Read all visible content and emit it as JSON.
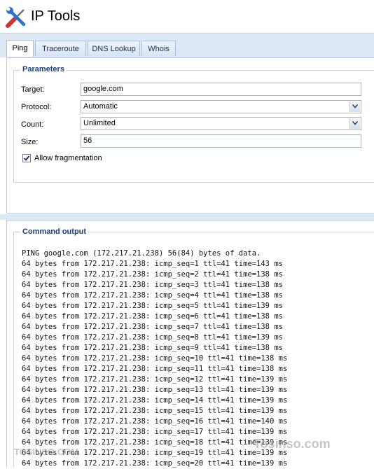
{
  "app": {
    "title": "IP Tools",
    "icon": "tools-icon"
  },
  "tabs": [
    {
      "label": "Ping",
      "active": true
    },
    {
      "label": "Traceroute",
      "active": false
    },
    {
      "label": "DNS Lookup",
      "active": false
    },
    {
      "label": "Whois",
      "active": false
    }
  ],
  "parameters": {
    "title": "Parameters",
    "target_label": "Target:",
    "target_value": "google.com",
    "protocol_label": "Protocol:",
    "protocol_value": "Automatic",
    "count_label": "Count:",
    "count_value": "Unlimited",
    "size_label": "Size:",
    "size_value": "56",
    "fragmentation_label": "Allow fragmentation",
    "fragmentation_checked": true
  },
  "output": {
    "title": "Command output",
    "lines": [
      "PING google.com (172.217.21.238) 56(84) bytes of data.",
      "64 bytes from 172.217.21.238: icmp_seq=1 ttl=41 time=143 ms",
      "64 bytes from 172.217.21.238: icmp_seq=2 ttl=41 time=138 ms",
      "64 bytes from 172.217.21.238: icmp_seq=3 ttl=41 time=138 ms",
      "64 bytes from 172.217.21.238: icmp_seq=4 ttl=41 time=138 ms",
      "64 bytes from 172.217.21.238: icmp_seq=5 ttl=41 time=139 ms",
      "64 bytes from 172.217.21.238: icmp_seq=6 ttl=41 time=138 ms",
      "64 bytes from 172.217.21.238: icmp_seq=7 ttl=41 time=138 ms",
      "64 bytes from 172.217.21.238: icmp_seq=8 ttl=41 time=139 ms",
      "64 bytes from 172.217.21.238: icmp_seq=9 ttl=41 time=138 ms",
      "64 bytes from 172.217.21.238: icmp_seq=10 ttl=41 time=138 ms",
      "64 bytes from 172.217.21.238: icmp_seq=11 ttl=41 time=138 ms",
      "64 bytes from 172.217.21.238: icmp_seq=12 ttl=41 time=139 ms",
      "64 bytes from 172.217.21.238: icmp_seq=13 ttl=41 time=139 ms",
      "64 bytes from 172.217.21.238: icmp_seq=14 ttl=41 time=139 ms",
      "64 bytes from 172.217.21.238: icmp_seq=15 ttl=41 time=139 ms",
      "64 bytes from 172.217.21.238: icmp_seq=16 ttl=41 time=140 ms",
      "64 bytes from 172.217.21.238: icmp_seq=17 ttl=41 time=139 ms",
      "64 bytes from 172.217.21.238: icmp_seq=18 ttl=41 time=139 ms",
      "64 bytes from 172.217.21.238: icmp_seq=19 ttl=41 time=139 ms",
      "64 bytes from 172.217.21.238: icmp_seq=20 ttl=41 time=139 ms"
    ]
  },
  "watermark": {
    "left": "TOSINSO.COM",
    "right": "Tosinso.com"
  },
  "colors": {
    "accent": "#1a3d7c",
    "tab_band": "#dde8f6"
  }
}
